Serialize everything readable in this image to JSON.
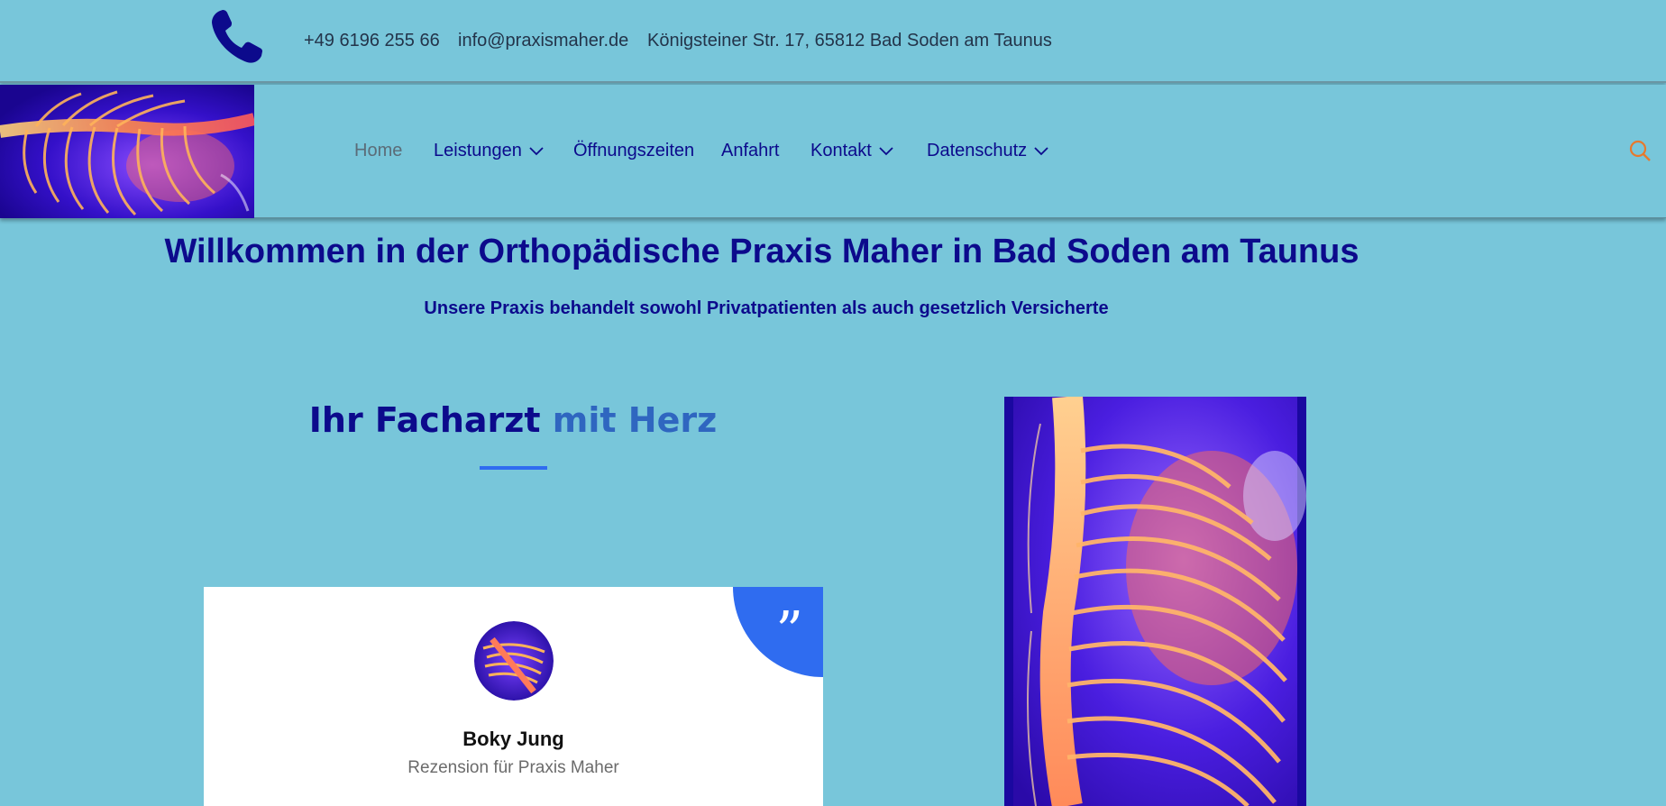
{
  "topbar": {
    "icon": "phone-icon",
    "phone": "+49 6196 255 66",
    "email": "info@praxismaher.de",
    "address": "Königsteiner Str. 17, 65812 Bad Soden am Taunus"
  },
  "header": {
    "logo_icon": "spine-image",
    "nav": [
      {
        "label": "Home",
        "active": true
      },
      {
        "label": "Leistungen",
        "dropdown": true
      },
      {
        "label": "Öffnungszeiten"
      },
      {
        "label": "Anfahrt"
      },
      {
        "label": "Kontakt",
        "dropdown": true
      },
      {
        "label": "Datenschutz",
        "dropdown": true
      }
    ],
    "search_icon": "search-icon"
  },
  "main": {
    "title": "Willkommen in der Orthopädische Praxis Maher in Bad Soden am Taunus",
    "subtitle": "Unsere Praxis behandelt sowohl Privatpatienten  als auch gesetzlich Versicherte",
    "section_heading_plain": "Ihr Facharzt",
    "section_heading_accent": "mit Herz",
    "testimonial": {
      "name": "Boky Jung",
      "subtitle": "Rezension für Praxis Maher",
      "quote_icon": "quote-icon"
    }
  },
  "colors": {
    "background": "#78c6da",
    "navy": "#0c0a8c",
    "accent_blue": "#2f6cf0",
    "search_orange": "#e8792c"
  }
}
